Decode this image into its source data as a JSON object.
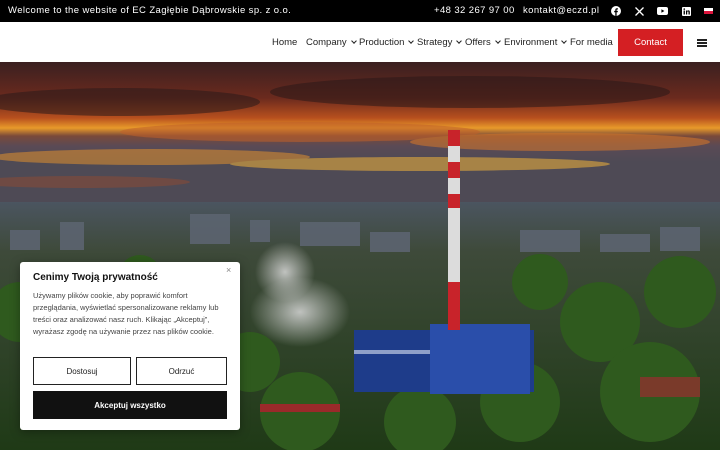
{
  "topbar": {
    "welcome": "Welcome to the website of EC Zagłębie Dąbrowskie sp. z o.o.",
    "phone": "+48 32 267 97 00",
    "email": "kontakt@eczd.pl",
    "social": [
      "facebook-icon",
      "x-icon",
      "youtube-icon",
      "linkedin-icon"
    ],
    "language": "pl-flag"
  },
  "nav": {
    "items": [
      {
        "label": "Home",
        "has_dropdown": false
      },
      {
        "label": "Company",
        "has_dropdown": true
      },
      {
        "label": "Production",
        "has_dropdown": true
      },
      {
        "label": "Strategy",
        "has_dropdown": true
      },
      {
        "label": "Offers",
        "has_dropdown": true
      },
      {
        "label": "Environment",
        "has_dropdown": true
      },
      {
        "label": "For media",
        "has_dropdown": false
      }
    ],
    "contact_label": "Contact",
    "accent_color": "#d41f23"
  },
  "cookie": {
    "title": "Cenimy Twoją prywatność",
    "body": "Używamy plików cookie, aby poprawić komfort przeglądania, wyświetlać spersonalizowane reklamy lub treści oraz analizować nasz ruch. Klikając „Akceptuj”, wyrażasz zgodę na używanie przez nas plików cookie.",
    "customize_label": "Dostosuj",
    "reject_label": "Odrzuć",
    "accept_label": "Akceptuj wszystko",
    "close_icon": "×"
  }
}
